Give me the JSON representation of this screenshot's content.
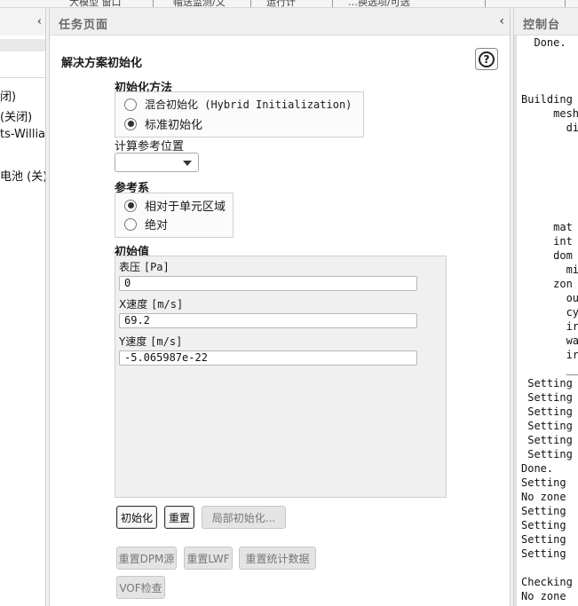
{
  "topbar": {
    "items": [
      "大模型  窗口",
      "帽送监测/文",
      "运行计",
      "…换选项/可选"
    ]
  },
  "left_panel": {
    "items": [
      "闭)",
      "(关闭)",
      "ts-Willian",
      "电池 (关)"
    ]
  },
  "task_panel": {
    "header_title": "任务页面",
    "section_title": "解决方案初始化",
    "init_method": {
      "label": "初始化方法",
      "options": [
        {
          "label": "混合初始化 (Hybrid Initialization)",
          "selected": false
        },
        {
          "label": "标准初始化",
          "selected": true
        }
      ]
    },
    "reference_location": {
      "label": "计算参考位置",
      "value": ""
    },
    "reference_frame": {
      "label": "参考系",
      "options": [
        {
          "label": "相对于单元区域",
          "selected": true
        },
        {
          "label": "绝对",
          "selected": false
        }
      ]
    },
    "initial_values": {
      "label": "初始值",
      "fields": [
        {
          "name": "表压",
          "unit": "[Pa]",
          "value": "0"
        },
        {
          "name": "X速度",
          "unit": "[m/s]",
          "value": "69.2"
        },
        {
          "name": "Y速度",
          "unit": "[m/s]",
          "value": "-5.065987e-22"
        }
      ]
    },
    "buttons": {
      "initialize": "初始化",
      "reset": "重置",
      "patch": "局部初始化...",
      "reset_dpm": "重置DPM源",
      "reset_lwf": "重置LWF",
      "reset_stats": "重置统计数据",
      "vof_check": "VOF检查"
    }
  },
  "console": {
    "title": "控制台",
    "lines": [
      "  Done.",
      "",
      "",
      "",
      "Building",
      "     mesh",
      "       di",
      "",
      "",
      "",
      "",
      "",
      "         ",
      "     mat",
      "     int",
      "     dom",
      "       mi",
      "     zon",
      "       ou",
      "       cy",
      "       ir",
      "       wa",
      "       ir",
      "       __",
      " Setting",
      " Setting",
      " Setting",
      " Setting",
      " Setting",
      " Setting",
      "Done.",
      "Setting",
      "No zone",
      "Setting",
      "Setting",
      "Setting",
      "Setting",
      "",
      "Checking",
      "No zone"
    ]
  },
  "icons": {
    "collapse": "chevron-left-icon",
    "help": "question-icon",
    "dropdown": "caret-down-icon"
  }
}
